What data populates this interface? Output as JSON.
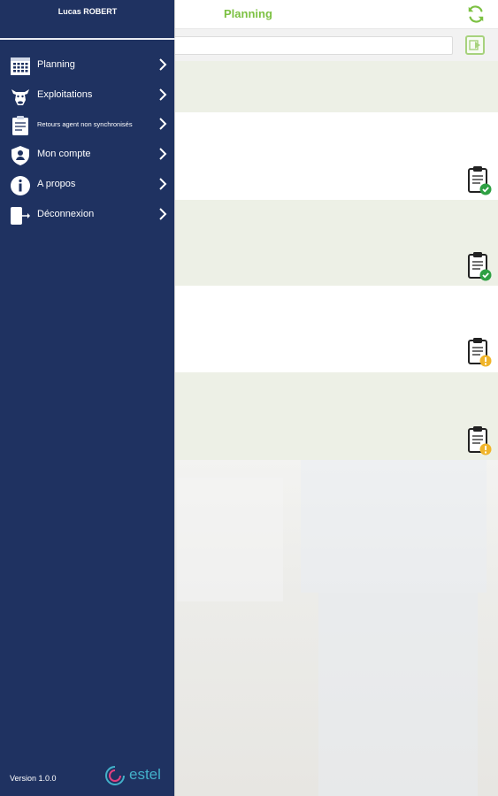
{
  "header": {
    "title": "Planning"
  },
  "drawer": {
    "user_name": "Lucas ROBERT",
    "items": [
      {
        "label": "Planning",
        "icon": "calendar-icon"
      },
      {
        "label": "Exploitations",
        "icon": "cow-icon"
      },
      {
        "label": "Retours agent non synchronisés",
        "icon": "clipboard-icon"
      },
      {
        "label": "Mon compte",
        "icon": "shield-icon"
      },
      {
        "label": "A propos",
        "icon": "info-icon"
      },
      {
        "label": "Déconnexion",
        "icon": "logout-icon"
      }
    ],
    "version": "Version 1.0.0",
    "brand": "estel"
  },
  "list": {
    "rows": [
      {
        "status": "complete",
        "status_color": "#2ea043"
      },
      {
        "status": "complete",
        "status_color": "#2ea043"
      },
      {
        "status": "warning",
        "status_color": "#f0b429"
      },
      {
        "status": "warning",
        "status_color": "#f0b429"
      }
    ]
  },
  "colors": {
    "accent": "#7cc142",
    "drawer": "#1f3261",
    "brand": "#43b0c9"
  }
}
